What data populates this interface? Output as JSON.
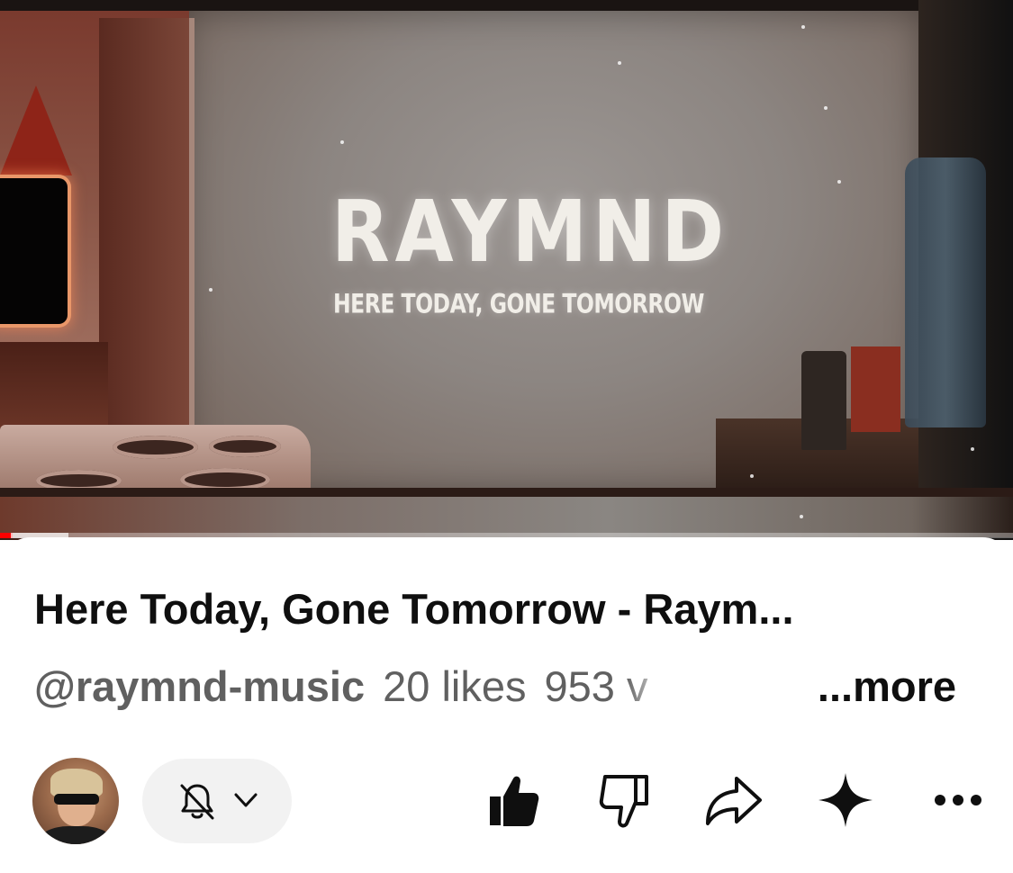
{
  "player": {
    "title_card": {
      "artist": "RAYMND",
      "song": "HERE TODAY, GONE TOMORROW"
    },
    "progress_fraction": 0.012,
    "colors": {
      "progress": "#ff0000"
    }
  },
  "video": {
    "title": "Here Today, Gone Tomorrow - Raym...",
    "channel_handle": "@raymnd-music",
    "likes": "20 likes",
    "views": "953 v",
    "more_label": "...more"
  },
  "actions": {
    "avatar_icon": "channel-avatar",
    "notification_icon": "bell-off-icon",
    "dropdown_icon": "chevron-down-icon",
    "like_icon": "thumbs-up-icon",
    "dislike_icon": "thumbs-down-icon",
    "share_icon": "share-arrow-icon",
    "ask_icon": "sparkle-icon",
    "overflow_icon": "ellipsis-icon"
  }
}
